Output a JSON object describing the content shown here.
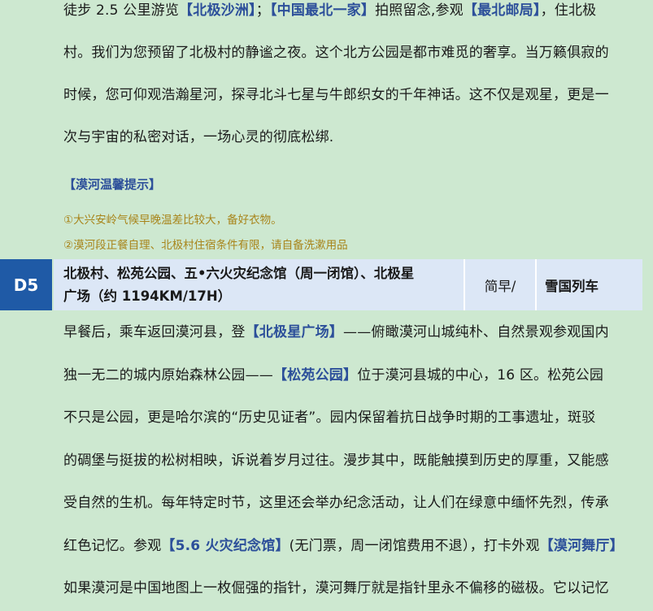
{
  "day4": {
    "lines": [
      [
        {
          "t": "徒步 2.5 公里游览"
        },
        {
          "t": "【北极沙洲】",
          "hl": true
        },
        {
          "t": "；"
        },
        {
          "t": "【中国最北一家】",
          "hl": true
        },
        {
          "t": "拍照留念,参观"
        },
        {
          "t": "【最北邮局】",
          "hl": true
        },
        {
          "t": "，住北极"
        }
      ],
      [
        {
          "t": "村。我们为您预留了北极村的静谧之夜。这个北方公园是都市难觅的奢享。当万籁俱寂的"
        }
      ],
      [
        {
          "t": "时候，您可仰观浩瀚星河，探寻北斗七星与牛郎织女的千年神话。这不仅是观星，更是一"
        }
      ],
      [
        {
          "t": "次与宇宙的私密对话，一场心灵的彻底松绑."
        }
      ]
    ]
  },
  "tips": {
    "title": "【漠河温馨提示】",
    "items": [
      "①大兴安岭气候早晚温差比较大，备好衣物。",
      "②漠河段正餐自理、北极村住宿条件有限，请自备洗漱用品"
    ]
  },
  "day5": {
    "badge": "D5",
    "route_line1": "北极村、松苑公园、五•六火灾纪念馆（周一闭馆）、北极星",
    "route_line2": "广场（约 1194KM/17H）",
    "meal": "简早/",
    "stay": "雪国列车",
    "lines": [
      [
        {
          "t": "早餐后，乘车返回漠河县，登"
        },
        {
          "t": "【北极星广场】",
          "hl": true
        },
        {
          "t": "——俯瞰漠河山城纯朴、自然景观参观国内"
        }
      ],
      [
        {
          "t": "独一无二的城内原始森林公园——"
        },
        {
          "t": "【松苑公园】",
          "hl": true
        },
        {
          "t": "位于漠河县城的中心，16 区。松苑公园"
        }
      ],
      [
        {
          "t": "不只是公园，更是哈尔滨的“历史见证者”。园内保留着抗日战争时期的工事遗址，斑驳"
        }
      ],
      [
        {
          "t": "的碉堡与挺拔的松树相映，诉说着岁月过往。漫步其中，既能触摸到历史的厚重，又能感"
        }
      ],
      [
        {
          "t": "受自然的生机。每年特定时节，这里还会举办纪念活动，让人们在绿意中缅怀先烈，传承"
        }
      ],
      [
        {
          "t": "红色记忆。参观"
        },
        {
          "t": "【5.6 火灾纪念馆】",
          "hl": true
        },
        {
          "t": "(无门票，周一闭馆费用不退），打卡外观"
        },
        {
          "t": "【漠河舞厅】",
          "hl": true
        }
      ],
      [
        {
          "t": "如果漠河是中国地图上一枚倔强的指针，漠河舞厅就是指针里永不偏移的磁极。它以记忆"
        }
      ]
    ]
  }
}
